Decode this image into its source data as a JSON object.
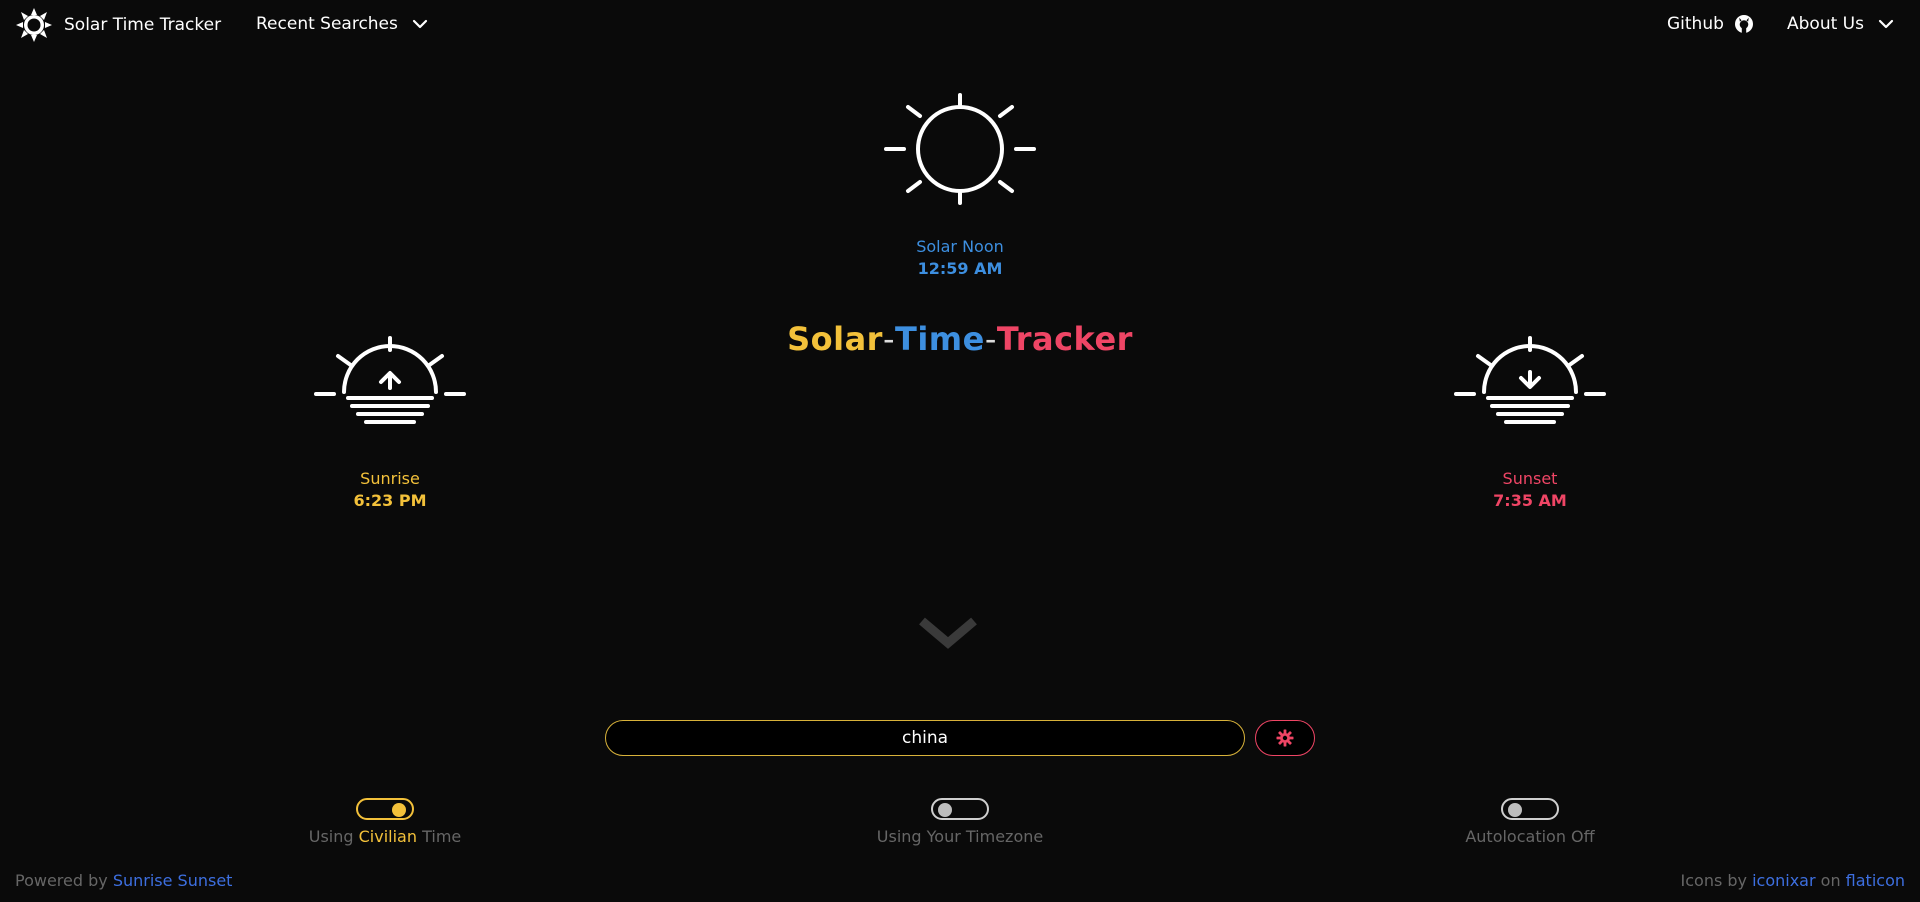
{
  "nav": {
    "brand": "Solar Time Tracker",
    "recent_searches": "Recent Searches",
    "github": "Github",
    "about": "About Us"
  },
  "title": {
    "part1": "Solar",
    "sep1": "-",
    "part2": "Time",
    "sep2": "-",
    "part3": "Tracker"
  },
  "solar_noon": {
    "label": "Solar Noon",
    "time": "12:59 AM"
  },
  "sunrise": {
    "label": "Sunrise",
    "time": "6:23 PM"
  },
  "sunset": {
    "label": "Sunset",
    "time": "7:35 AM"
  },
  "search": {
    "value": "china",
    "button_icon": "gear-icon"
  },
  "toggles": [
    {
      "prefix": "Using ",
      "highlight": "Civilian",
      "suffix": " Time",
      "state": "on"
    },
    {
      "text": "Using Your Timezone",
      "state": "off"
    },
    {
      "text": "Autolocation Off",
      "state": "off"
    }
  ],
  "footer": {
    "powered_by": "Powered by ",
    "powered_link": "Sunrise Sunset",
    "icons_by": "Icons by ",
    "icons_author": "iconixar",
    "on": " on ",
    "icons_site": "flaticon"
  },
  "colors": {
    "yellow": "#f3c13a",
    "blue": "#3d8fe0",
    "red": "#ef4565",
    "link": "#3d6fe0",
    "background": "#0a0a0a"
  }
}
